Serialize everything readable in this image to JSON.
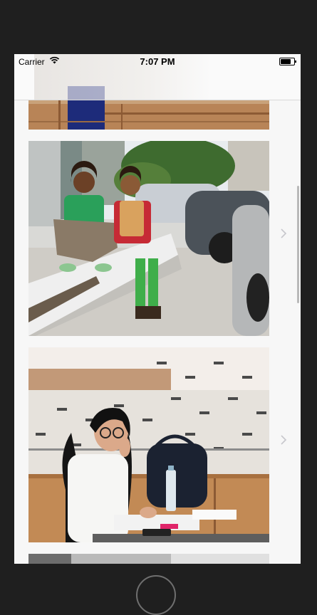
{
  "status_bar": {
    "carrier": "Carrier",
    "time": "7:07 PM",
    "wifi_icon": "wifi-icon",
    "battery_icon": "battery-icon"
  },
  "list": {
    "items": [
      {
        "name": "partial-photo-top",
        "icon": "chevron-right-icon"
      },
      {
        "name": "photo-kids-sitting-on-curb",
        "icon": "chevron-right-icon"
      },
      {
        "name": "photo-woman-studying-at-table",
        "icon": "chevron-right-icon"
      },
      {
        "name": "partial-photo-bottom",
        "icon": "chevron-right-icon"
      }
    ]
  },
  "colors": {
    "device_frame": "#1f1f1f",
    "screen_background": "#f7f7f7",
    "chevron": "#c7c7cc"
  }
}
